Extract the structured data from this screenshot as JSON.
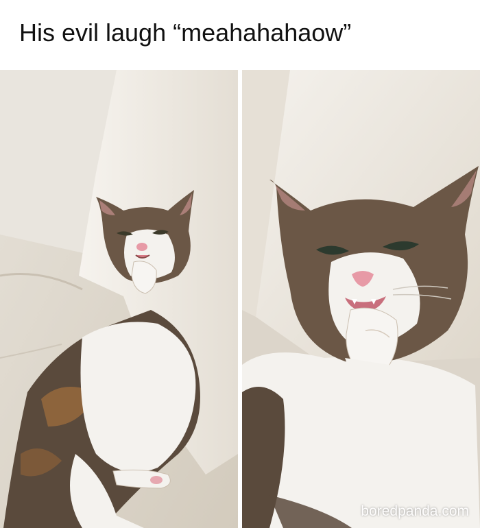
{
  "meme": {
    "caption": "His evil laugh “meahahahaow”",
    "watermark": "boredpanda.com"
  },
  "panels": [
    {
      "subject": "cat",
      "view": "full-body"
    },
    {
      "subject": "cat",
      "view": "close-up"
    }
  ],
  "colors": {
    "background": "#ffffff",
    "caption_text": "#111111",
    "sofa_light": "#efebe3",
    "sofa_shadow": "#d8d1c5",
    "cat_white": "#f4f2ee",
    "cat_tabby": "#5a4a3c",
    "nose_pink": "#e79aa6"
  }
}
